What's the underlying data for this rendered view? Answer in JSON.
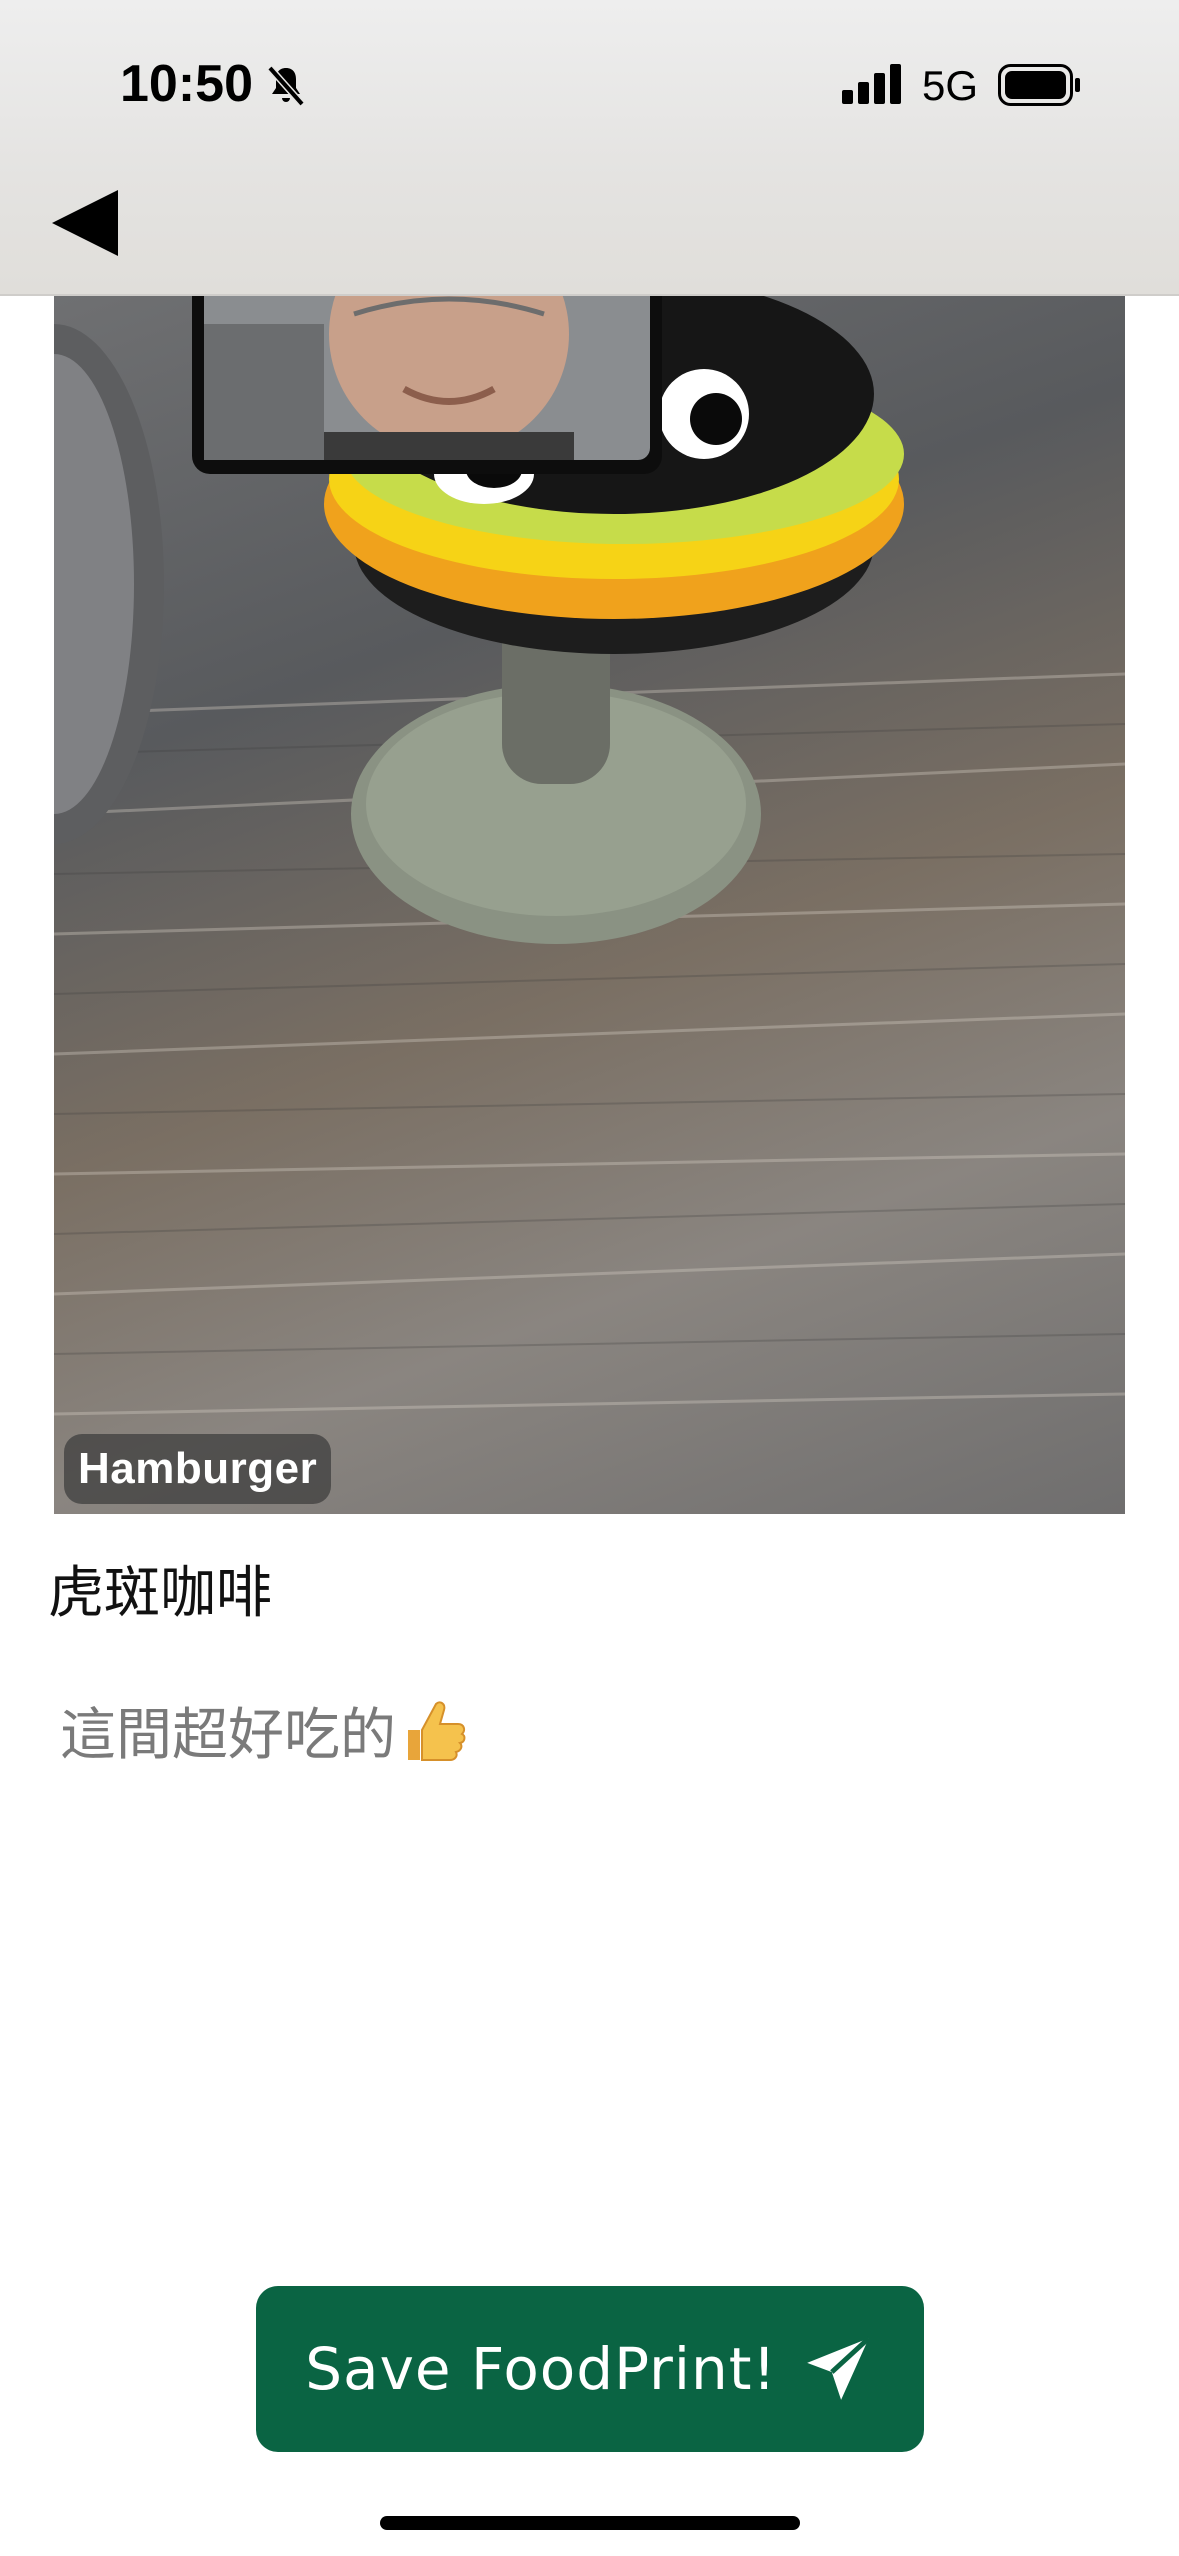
{
  "status_bar": {
    "time": "10:50",
    "network": "5G",
    "icons": [
      "bell-slash-icon",
      "signal-icon",
      "battery-icon"
    ]
  },
  "header": {
    "back_icon": "back-arrow-icon"
  },
  "photo": {
    "label": "Hamburger"
  },
  "post": {
    "place_name": "虎斑咖啡",
    "review": "這間超好吃的"
  },
  "actions": {
    "save_label": "Save FoodPrint!",
    "save_icon": "send-icon"
  },
  "colors": {
    "accent": "#0a6443",
    "review_text": "#7a7a7a"
  }
}
